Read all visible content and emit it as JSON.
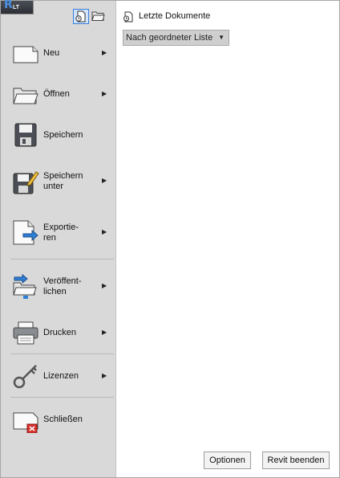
{
  "app_button": {
    "letter": "R",
    "badge": "LT"
  },
  "menu": [
    {
      "label": "Neu",
      "has_submenu": true,
      "icon": "new-document-icon"
    },
    {
      "label": "Öffnen",
      "has_submenu": true,
      "icon": "open-folder-icon"
    },
    {
      "label": "Speichern",
      "has_submenu": false,
      "icon": "save-disk-icon"
    },
    {
      "label": "Speichern\nunter",
      "has_submenu": true,
      "icon": "save-as-icon"
    },
    {
      "label": "Exportie-\nren",
      "has_submenu": true,
      "icon": "export-icon"
    },
    {
      "label": "Veröffent-\nlichen",
      "has_submenu": true,
      "icon": "publish-icon"
    },
    {
      "label": "Drucken",
      "has_submenu": true,
      "icon": "printer-icon"
    },
    {
      "label": "Lizenzen",
      "has_submenu": true,
      "icon": "key-icon"
    },
    {
      "label": "Schließen",
      "has_submenu": false,
      "icon": "close-document-icon"
    }
  ],
  "submenu_arrow": "▶",
  "recent": {
    "title": "Letzte Dokumente",
    "sort_selected": "Nach geordneter Liste",
    "caret": "▼"
  },
  "footer": {
    "options_label": "Optionen",
    "exit_label": "Revit beenden"
  },
  "colors": {
    "accent": "#3b7dd8",
    "sidebar": "#d9d9d9",
    "close_red": "#d9302b"
  }
}
